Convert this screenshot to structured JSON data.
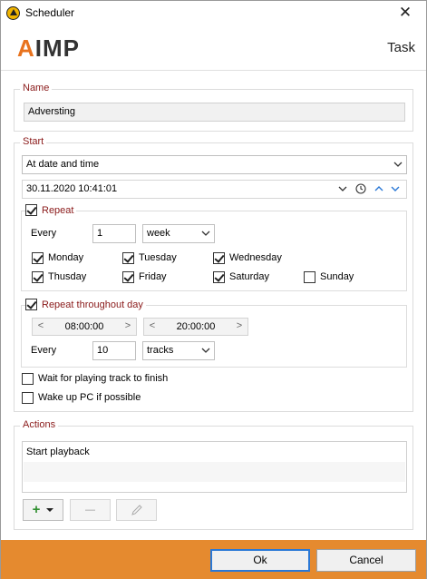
{
  "window": {
    "title": "Scheduler",
    "close_glyph": "✕"
  },
  "header": {
    "logo_a": "A",
    "logo_rest": "IMP",
    "title": "Task"
  },
  "name_group": {
    "legend": "Name",
    "value": "Adversting"
  },
  "start_group": {
    "legend": "Start",
    "mode": "At date and time",
    "datetime": "30.11.2020 10:41:01",
    "icons": [
      "chevron-down-icon",
      "clock-icon",
      "chevron-up-icon",
      "chevron-down-icon"
    ]
  },
  "repeat_group": {
    "legend": "Repeat",
    "checked": true,
    "every_label": "Every",
    "every_value": "1",
    "period": "week",
    "days": [
      {
        "label": "Monday",
        "checked": true
      },
      {
        "label": "Tuesday",
        "checked": true
      },
      {
        "label": "Wednesday",
        "checked": true
      },
      {
        "label": "Thusday",
        "checked": true
      },
      {
        "label": "Friday",
        "checked": true
      },
      {
        "label": "Saturday",
        "checked": true
      },
      {
        "label": "Sunday",
        "checked": false
      }
    ]
  },
  "throughout_group": {
    "legend": "Repeat throughout day",
    "checked": true,
    "from": "08:00:00",
    "to": "20:00:00",
    "every_label": "Every",
    "every_value": "10",
    "unit": "tracks"
  },
  "options": {
    "wait_label": "Wait for playing track to finish",
    "wait_checked": false,
    "wake_label": "Wake up PC if possible",
    "wake_checked": false
  },
  "actions_group": {
    "legend": "Actions",
    "items": [
      "Start playback"
    ],
    "add_glyph": "+",
    "remove_glyph": "—"
  },
  "footer": {
    "ok_label": "Ok",
    "cancel_label": "Cancel"
  },
  "colors": {
    "accent": "#e58a2f",
    "legend": "#8a1a1a",
    "focus": "#2a78d6"
  }
}
